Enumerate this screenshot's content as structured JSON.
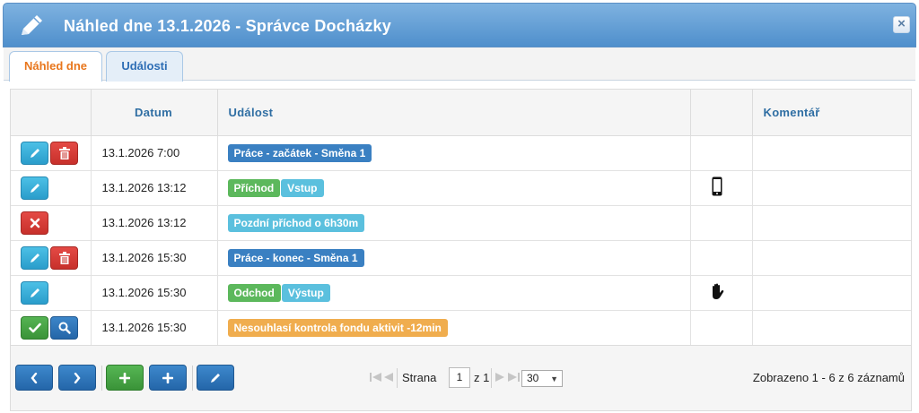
{
  "window": {
    "title": "Náhled dne 13.1.2026 - Správce Docházky",
    "close_label": "×"
  },
  "tabs": [
    {
      "label": "Náhled dne",
      "active": true
    },
    {
      "label": "Události",
      "active": false
    }
  ],
  "table": {
    "columns": [
      "",
      "Datum",
      "Událost",
      "",
      "Komentář"
    ],
    "rows": [
      {
        "actions": [
          "edit",
          "delete"
        ],
        "datum": "13.1.2026 7:00",
        "badges": [
          {
            "text": "Práce - začátek - Směna 1",
            "color": "#3a80c2"
          }
        ],
        "device": "",
        "comment": ""
      },
      {
        "actions": [
          "edit"
        ],
        "datum": "13.1.2026 13:12",
        "badges": [
          {
            "text": "Příchod",
            "color": "#5cb85c"
          },
          {
            "text": "Vstup",
            "color": "#5bc0de"
          }
        ],
        "device": "mobile-phone-icon",
        "comment": ""
      },
      {
        "actions": [
          "reject"
        ],
        "datum": "13.1.2026 13:12",
        "badges": [
          {
            "text": "Pozdní příchod o 6h30m",
            "color": "#5bc0de"
          }
        ],
        "device": "",
        "comment": ""
      },
      {
        "actions": [
          "edit",
          "delete"
        ],
        "datum": "13.1.2026 15:30",
        "badges": [
          {
            "text": "Práce - konec - Směna 1",
            "color": "#3a80c2"
          }
        ],
        "device": "",
        "comment": ""
      },
      {
        "actions": [
          "edit"
        ],
        "datum": "13.1.2026 15:30",
        "badges": [
          {
            "text": "Odchod",
            "color": "#5cb85c"
          },
          {
            "text": "Výstup",
            "color": "#5bc0de"
          }
        ],
        "device": "hand-icon",
        "comment": ""
      },
      {
        "actions": [
          "approve",
          "search"
        ],
        "datum": "13.1.2026 15:30",
        "badges": [
          {
            "text": "Nesouhlasí kontrola fondu aktivit -12min",
            "color": "#f0ad4e"
          }
        ],
        "device": "",
        "comment": ""
      }
    ]
  },
  "pager": {
    "page_label": "Strana",
    "page_value": "1",
    "of_label": "z 1",
    "per_page": "30",
    "records_text": "Zobrazeno 1 - 6 z 6 záznamů"
  }
}
